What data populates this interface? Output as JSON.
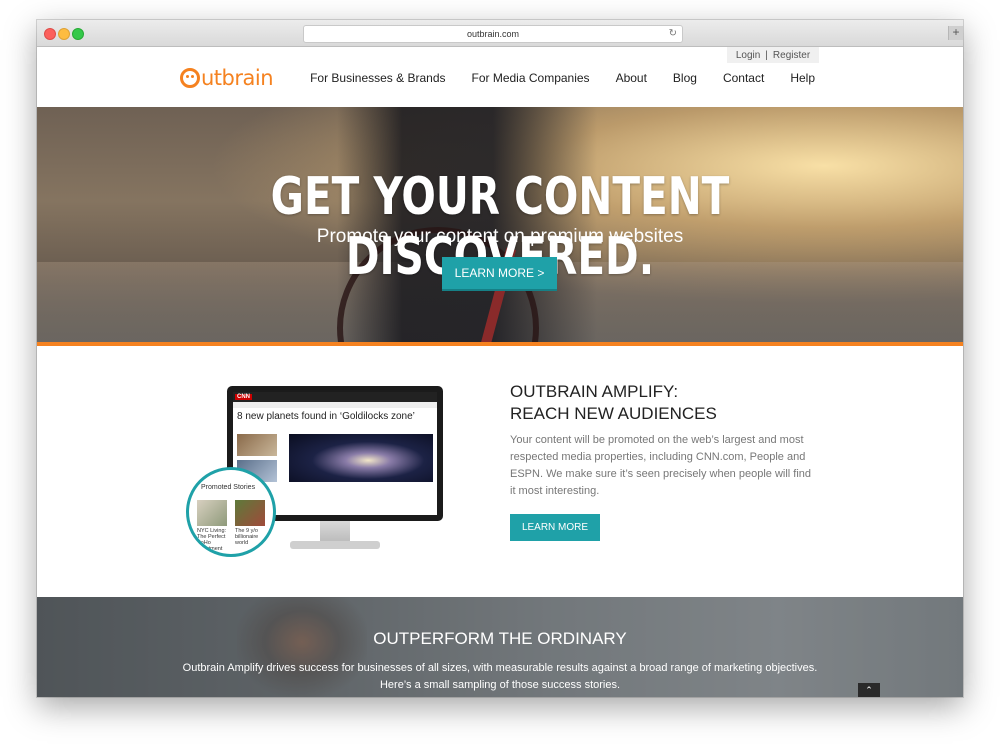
{
  "browser": {
    "url": "outbrain.com",
    "new_tab_label": "+"
  },
  "header": {
    "logo_text": "utbrain",
    "auth": {
      "login": "Login",
      "separator": "|",
      "register": "Register"
    },
    "nav": [
      "For Businesses & Brands",
      "For Media Companies",
      "About",
      "Blog",
      "Contact",
      "Help"
    ]
  },
  "hero": {
    "title": "GET YOUR CONTENT DISCOVERED.",
    "subtitle": "Promote your content on premium websites",
    "button": "LEARN MORE >"
  },
  "amplify": {
    "title_line1": "OUTBRAIN AMPLIFY:",
    "title_line2": "REACH NEW AUDIENCES",
    "text": "Your content will be promoted on the web’s largest and most respected media properties, including CNN.com, People and ESPN. We make sure it’s seen precisely when people will find it most interesting.",
    "button": "LEARN MORE",
    "screen": {
      "brand": "CNN",
      "headline": "8 new planets found in ‘Goldilocks zone’",
      "promoted_title": "Promoted Stories",
      "promoted_left": "NYC Living: The Perfect SoHo Apartment",
      "promoted_right": "The 9 y/o billionaire world"
    }
  },
  "outperform": {
    "title": "OUTPERFORM THE ORDINARY",
    "line1": "Outbrain Amplify drives success for businesses of all sizes, with measurable results against a broad range of marketing objectives.",
    "line2": "Here’s a small sampling of those success stories.",
    "scroll_top": "⌃"
  },
  "colors": {
    "brand_orange": "#f58220",
    "teal": "#1fa1a8"
  }
}
